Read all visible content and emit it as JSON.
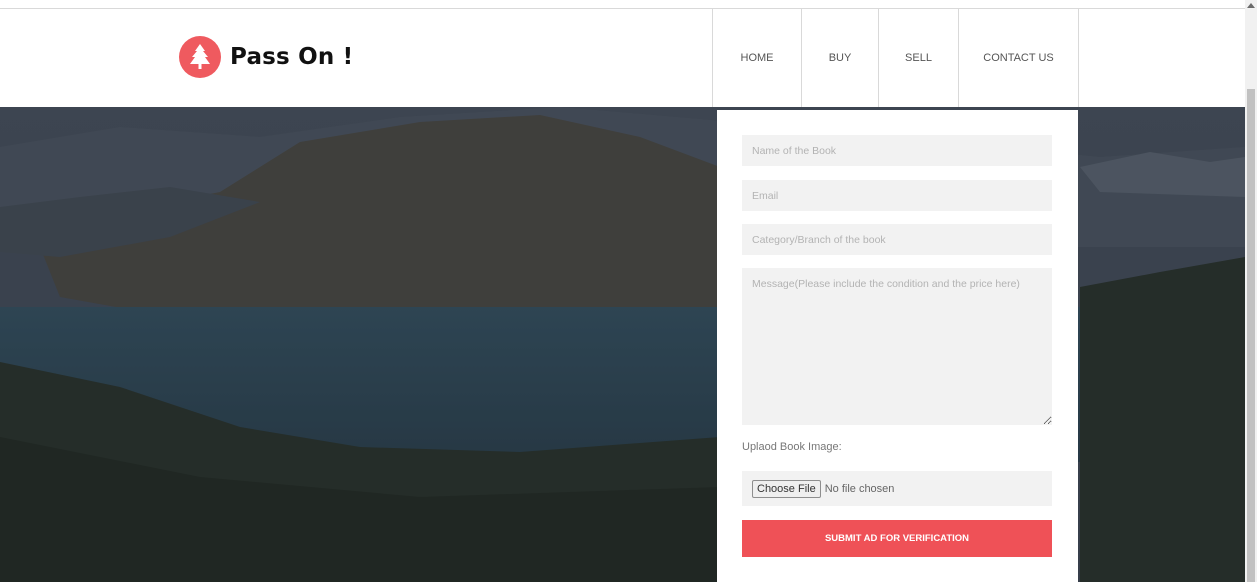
{
  "brand": {
    "name": "Pass On !",
    "logo_icon": "tree-icon",
    "accent": "#ef5a5f"
  },
  "nav": {
    "items": [
      {
        "label": "HOME"
      },
      {
        "label": "BUY"
      },
      {
        "label": "SELL"
      },
      {
        "label": "CONTACT US"
      }
    ]
  },
  "form": {
    "book_name_placeholder": "Name of the Book",
    "email_placeholder": "Email",
    "category_placeholder": "Category/Branch of the book",
    "message_placeholder": "Message(Please include the condition and the price here)",
    "upload_label": "Uplaod Book Image:",
    "choose_file_label": "Choose File",
    "file_status": "No file chosen",
    "submit_label": "SUBMIT AD FOR VERIFICATION",
    "submit_color": "#ef5157"
  }
}
